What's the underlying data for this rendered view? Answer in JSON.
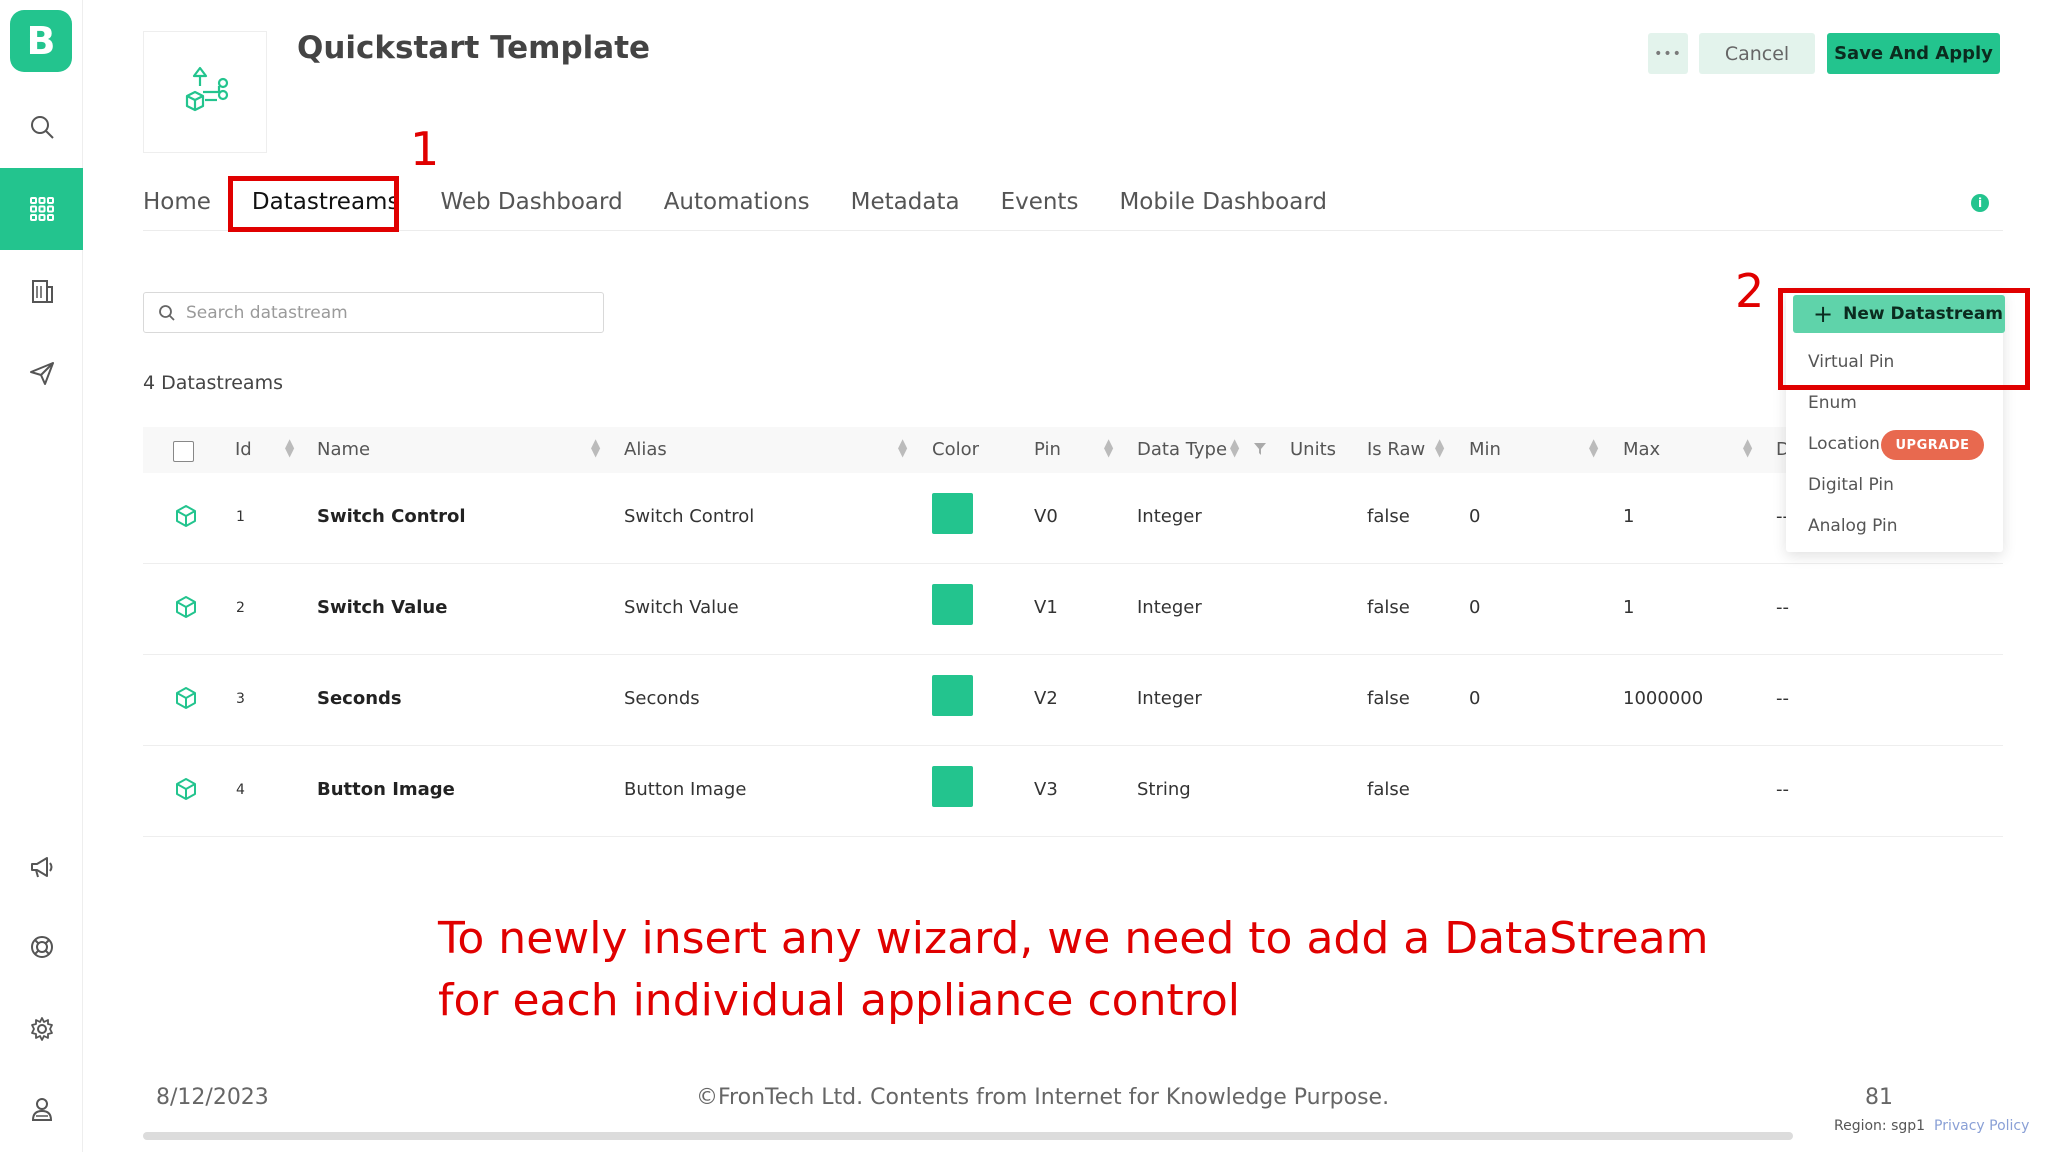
{
  "app": {
    "logo_letter": "B",
    "template_title": "Quickstart Template",
    "accent_color": "#23c48e"
  },
  "sidebar": {
    "items": [
      {
        "icon": "search-icon"
      },
      {
        "icon": "grid-icon",
        "active": true
      },
      {
        "icon": "building-icon"
      },
      {
        "icon": "send-icon"
      },
      {
        "icon": "megaphone-icon"
      },
      {
        "icon": "help-ring-icon"
      },
      {
        "icon": "gear-icon"
      },
      {
        "icon": "user-icon"
      }
    ]
  },
  "header": {
    "more_label": "•••",
    "cancel_label": "Cancel",
    "save_label": "Save And Apply"
  },
  "tabs": [
    {
      "label": "Home"
    },
    {
      "label": "Datastreams",
      "active": true
    },
    {
      "label": "Web Dashboard"
    },
    {
      "label": "Automations"
    },
    {
      "label": "Metadata"
    },
    {
      "label": "Events"
    },
    {
      "label": "Mobile Dashboard"
    }
  ],
  "info_label": "i",
  "search": {
    "placeholder": "Search datastream"
  },
  "datastream_count": "4 Datastreams",
  "table": {
    "headers": {
      "id": "Id",
      "name": "Name",
      "alias": "Alias",
      "color": "Color",
      "pin": "Pin",
      "data_type": "Data Type",
      "units": "Units",
      "is_raw": "Is Raw",
      "min": "Min",
      "max": "Max",
      "d": "D"
    },
    "rows": [
      {
        "id": "1",
        "name": "Switch Control",
        "alias": "Switch Control",
        "color": "#23c48e",
        "pin": "V0",
        "data_type": "Integer",
        "is_raw": "false",
        "min": "0",
        "max": "1",
        "d": "--"
      },
      {
        "id": "2",
        "name": "Switch Value",
        "alias": "Switch Value",
        "color": "#23c48e",
        "pin": "V1",
        "data_type": "Integer",
        "is_raw": "false",
        "min": "0",
        "max": "1",
        "d": "--"
      },
      {
        "id": "3",
        "name": "Seconds",
        "alias": "Seconds",
        "color": "#23c48e",
        "pin": "V2",
        "data_type": "Integer",
        "is_raw": "false",
        "min": "0",
        "max": "1000000",
        "d": "--"
      },
      {
        "id": "4",
        "name": "Button Image",
        "alias": "Button Image",
        "color": "#23c48e",
        "pin": "V3",
        "data_type": "String",
        "is_raw": "false",
        "min": "",
        "max": "",
        "d": "--"
      }
    ]
  },
  "new_datastream": {
    "button_label": "New Datastream",
    "menu": [
      "Virtual Pin",
      "Enum",
      "Location",
      "Digital Pin",
      "Analog Pin"
    ],
    "upgrade_badge": "UPGRADE"
  },
  "annotations": {
    "step1": "1",
    "step2": "2",
    "caption_line1": "To newly insert any wizard, we need to add a DataStream",
    "caption_line2": "for each individual appliance control",
    "color": "#e00000"
  },
  "footer": {
    "date": "8/12/2023",
    "copyright": "©FronTech Ltd. Contents from Internet for Knowledge Purpose.",
    "page_number": "81",
    "region": "Region: sgp1",
    "privacy": "Privacy Policy"
  }
}
